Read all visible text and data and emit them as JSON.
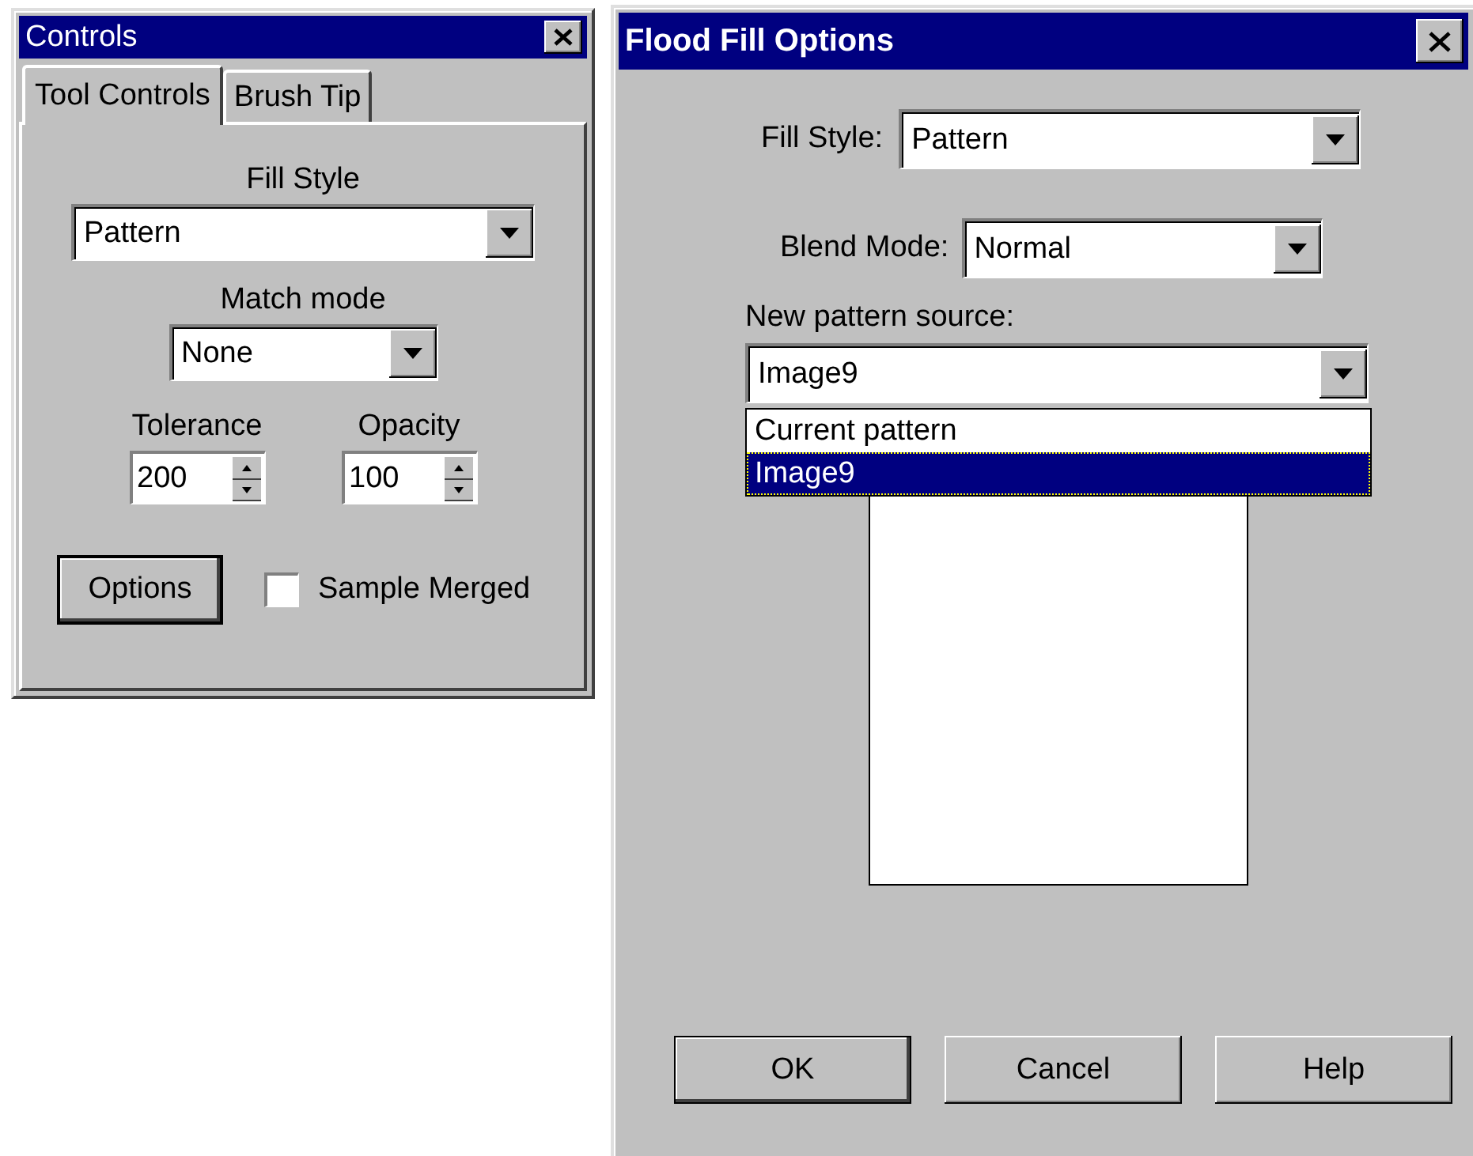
{
  "controls_window": {
    "title": "Controls",
    "tabs": [
      {
        "label": "Tool Controls",
        "selected": true
      },
      {
        "label": "Brush Tip",
        "selected": false
      }
    ],
    "fill_style": {
      "label": "Fill Style",
      "value": "Pattern"
    },
    "match_mode": {
      "label": "Match mode",
      "value": "None"
    },
    "tolerance": {
      "label": "Tolerance",
      "value": "200"
    },
    "opacity": {
      "label": "Opacity",
      "value": "100"
    },
    "options_button": "Options",
    "sample_merged": {
      "label": "Sample Merged",
      "checked": false
    }
  },
  "flood_fill_dialog": {
    "title": "Flood Fill Options",
    "fill_style": {
      "label": "Fill Style:",
      "value": "Pattern"
    },
    "blend_mode": {
      "label": "Blend Mode:",
      "value": "Normal"
    },
    "pattern_source": {
      "label": "New pattern source:",
      "value": "Image9",
      "open": true,
      "options": [
        {
          "label": "Current pattern",
          "selected": false
        },
        {
          "label": "Image9",
          "selected": true
        }
      ]
    },
    "buttons": [
      {
        "label": "OK",
        "default": true
      },
      {
        "label": "Cancel",
        "default": false
      },
      {
        "label": "Help",
        "default": false
      }
    ]
  }
}
